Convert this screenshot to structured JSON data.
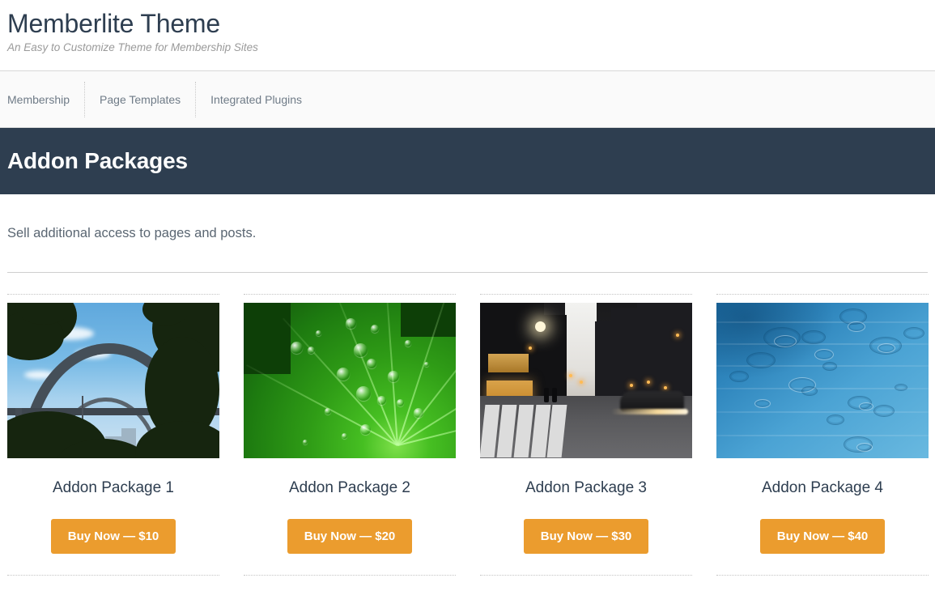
{
  "header": {
    "site_title": "Memberlite Theme",
    "tagline": "An Easy to Customize Theme for Membership Sites"
  },
  "nav": {
    "items": [
      {
        "label": "Membership"
      },
      {
        "label": "Page Templates"
      },
      {
        "label": "Integrated Plugins"
      }
    ]
  },
  "banner": {
    "title": "Addon Packages",
    "background_color": "#2e3e50"
  },
  "main": {
    "intro": "Sell additional access to pages and posts.",
    "packages": [
      {
        "title": "Addon Package 1",
        "buy_label": "Buy Now — $10",
        "image_alt": "Steel arch bridge against blue sky framed by dark tree foliage"
      },
      {
        "title": "Addon Package 2",
        "buy_label": "Buy Now — $20",
        "image_alt": "Close-up of a green leaf covered in water droplets"
      },
      {
        "title": "Addon Package 3",
        "buy_label": "Buy Now — $30",
        "image_alt": "City street at dusk with crosswalk and car light trails"
      },
      {
        "title": "Addon Package 4",
        "buy_label": "Buy Now — $40",
        "image_alt": "Blue water surface with raindrop ripple rings"
      }
    ]
  },
  "theme": {
    "accent_button": "#eb9c2e",
    "dark_navy": "#2e3e50",
    "muted_text": "#6f7b87"
  }
}
